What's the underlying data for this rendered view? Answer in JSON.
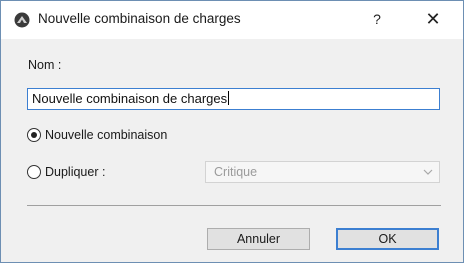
{
  "window": {
    "title": "Nouvelle combinaison de charges",
    "help_label": "?",
    "close_label": "✕"
  },
  "form": {
    "name_label": "Nom :",
    "name_value": "Nouvelle combinaison de charges",
    "options": [
      {
        "label": "Nouvelle combinaison",
        "selected": true
      },
      {
        "label": "Dupliquer :",
        "selected": false
      }
    ],
    "duplicate_select": {
      "value": "Critique",
      "enabled": false
    }
  },
  "buttons": {
    "cancel_label": "Annuler",
    "ok_label": "OK"
  },
  "colors": {
    "accent": "#3c7fd1",
    "dialog_background": "#f0f0f0",
    "button_background": "#e1e1e1",
    "disabled_text": "#9b9b9b"
  },
  "icons": {
    "app": "archicad-app-icon",
    "close": "close-icon",
    "help": "help-icon",
    "dropdown": "chevron-down-icon"
  }
}
